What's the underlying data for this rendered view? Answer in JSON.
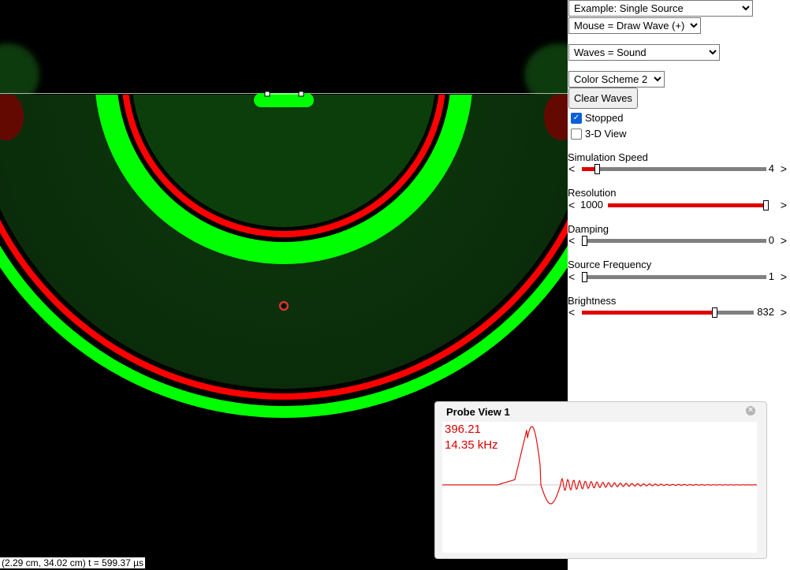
{
  "controls": {
    "example": "Example: Single Source",
    "mouse": "Mouse = Draw Wave (+)",
    "waves": "Waves = Sound",
    "color_scheme": "Color Scheme 2",
    "clear_button": "Clear Waves",
    "stopped_label": "Stopped",
    "stopped_checked": true,
    "view3d_label": "3-D View",
    "view3d_checked": false
  },
  "sliders": [
    {
      "label": "Simulation Speed",
      "value": "4",
      "fraction": 0.08
    },
    {
      "label": "Resolution",
      "value": "1000",
      "fraction": 1.0
    },
    {
      "label": "Damping",
      "value": "0",
      "fraction": 0.0
    },
    {
      "label": "Source Frequency",
      "value": "1",
      "fraction": 0.0
    },
    {
      "label": "Brightness",
      "value": "832",
      "fraction": 0.77
    }
  ],
  "status": {
    "coordinates": "(2.29 cm, 34.02 cm) t = 599.37 µs"
  },
  "probe": {
    "title": "Probe View 1",
    "value": "396.21",
    "frequency": "14.35 kHz",
    "close_icon": "close-circle-icon"
  },
  "colors": {
    "wave_green": "#00ff00",
    "wave_red": "#ff0000",
    "slider_fill": "#e00000",
    "probe_text": "#d80000"
  }
}
